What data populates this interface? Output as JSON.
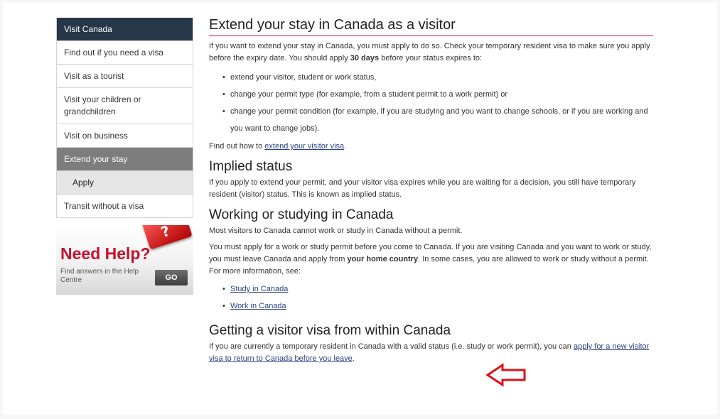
{
  "sidebar": {
    "items": [
      {
        "label": "Visit Canada"
      },
      {
        "label": "Find out if you need a visa"
      },
      {
        "label": "Visit as a tourist"
      },
      {
        "label": "Visit your children or grandchildren"
      },
      {
        "label": "Visit on business"
      },
      {
        "label": "Extend your stay"
      },
      {
        "label": "Apply"
      },
      {
        "label": "Transit without a visa"
      }
    ],
    "help": {
      "title": "Need Help?",
      "subtitle": "Find answers in the Help Centre",
      "button": "GO",
      "icon": "question-mark-icon"
    }
  },
  "main": {
    "title": "Extend your stay in Canada as a visitor",
    "intro_a": "If you want to extend your stay in Canada, you must apply to do so. Check your temporary resident visa to make sure you apply before the expiry date. You should apply ",
    "intro_bold": "30 days",
    "intro_b": " before your status expires to:",
    "bullets": [
      "extend your visitor, student or work status,",
      "change your permit type (for example, from a student permit to a work permit) or",
      "change your permit condition (for example, if you are studying and you want to change schools, or if you are working and you want to change jobs)."
    ],
    "findout_pre": "Find out how to ",
    "findout_link": "extend your visitor visa",
    "findout_post": ".",
    "implied": {
      "heading": "Implied status",
      "text": "If you apply to extend your permit, and your visitor visa expires while you are waiting for a decision, you still have temporary resident (visitor) status. This is known as implied status."
    },
    "working": {
      "heading": "Working or studying in Canada",
      "p1": "Most visitors to Canada cannot work or study in Canada without a permit.",
      "p2_a": "You must apply for a work or study permit before you come to Canada. If you are visiting Canada and you want to work or study, you must leave Canada and apply from ",
      "p2_bold": "your home country",
      "p2_b": ". In some cases, you are allowed to work or study without a permit. For more information, see:",
      "links": [
        "Study in Canada",
        "Work in Canada"
      ]
    },
    "getting": {
      "heading": "Getting a visitor visa from within Canada",
      "text_a": "If you are currently a temporary resident in Canada with a valid status (i.e. study or work permit), you can ",
      "link": "apply for a new visitor visa to return to Canada before you leave",
      "text_b": "."
    }
  },
  "colors": {
    "nav_active": "#26374a",
    "nav_selected": "#7d7d7d",
    "accent_red": "#c8102e",
    "link": "#2b4380"
  },
  "annotation": {
    "icon": "left-arrow-icon",
    "color": "#e0101a"
  }
}
